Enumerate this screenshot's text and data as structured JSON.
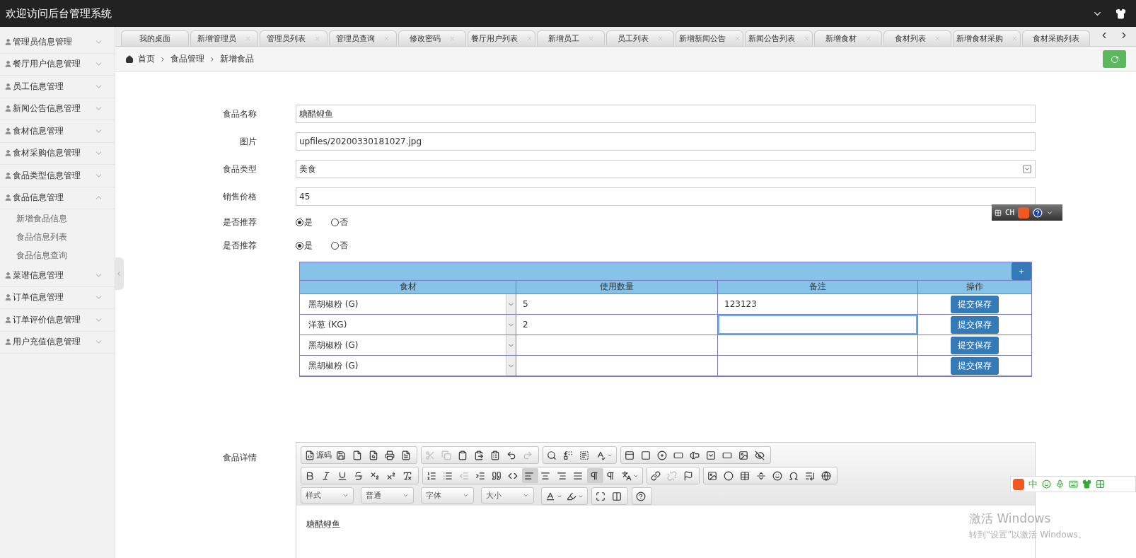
{
  "header": {
    "title": "欢迎访问后台管理系统"
  },
  "sidebar": {
    "items": [
      {
        "label": "管理员信息管理",
        "expanded": false
      },
      {
        "label": "餐厅用户信息管理",
        "expanded": false
      },
      {
        "label": "员工信息管理",
        "expanded": false
      },
      {
        "label": "新闻公告信息管理",
        "expanded": false
      },
      {
        "label": "食材信息管理",
        "expanded": false
      },
      {
        "label": "食材采购信息管理",
        "expanded": false
      },
      {
        "label": "食品类型信息管理",
        "expanded": false
      },
      {
        "label": "食品信息管理",
        "expanded": true,
        "children": [
          {
            "label": "新增食品信息"
          },
          {
            "label": "食品信息列表"
          },
          {
            "label": "食品信息查询"
          }
        ]
      },
      {
        "label": "菜谱信息管理",
        "expanded": false
      },
      {
        "label": "订单信息管理",
        "expanded": false
      },
      {
        "label": "订单评价信息管理",
        "expanded": false
      },
      {
        "label": "用户充值信息管理",
        "expanded": false
      }
    ]
  },
  "tabs": [
    {
      "label": "我的桌面",
      "closable": false,
      "selected": false
    },
    {
      "label": "新增管理员",
      "closable": true,
      "selected": false
    },
    {
      "label": "管理员列表",
      "closable": true,
      "selected": false
    },
    {
      "label": "管理员查询",
      "closable": true,
      "selected": false
    },
    {
      "label": "修改密码",
      "closable": true,
      "selected": false
    },
    {
      "label": "餐厅用户列表",
      "closable": true,
      "selected": false
    },
    {
      "label": "新增员工",
      "closable": true,
      "selected": false
    },
    {
      "label": "员工列表",
      "closable": true,
      "selected": false
    },
    {
      "label": "新增新闻公告",
      "closable": true,
      "selected": false
    },
    {
      "label": "新闻公告列表",
      "closable": true,
      "selected": false
    },
    {
      "label": "新增食材",
      "closable": true,
      "selected": false
    },
    {
      "label": "食材列表",
      "closable": true,
      "selected": false
    },
    {
      "label": "新增食材采购",
      "closable": true,
      "selected": false
    },
    {
      "label": "食材采购列表",
      "closable": false,
      "selected": false
    }
  ],
  "breadcrumb": [
    "首页",
    "食品管理",
    "新增食品"
  ],
  "form": {
    "fields": [
      {
        "kind": "text",
        "label": "食品名称",
        "value": "糖醋鲤鱼"
      },
      {
        "kind": "text",
        "label": "图片",
        "value": "upfiles/20200330181027.jpg"
      },
      {
        "kind": "select",
        "label": "食品类型",
        "value": "美食"
      },
      {
        "kind": "text",
        "label": "销售价格",
        "value": "45"
      },
      {
        "kind": "radio",
        "label": "是否推荐",
        "options": [
          {
            "label": "是",
            "selected": true
          },
          {
            "label": "否",
            "selected": false
          }
        ]
      },
      {
        "kind": "radio",
        "label": "是否推荐",
        "options": [
          {
            "label": "是",
            "selected": true
          },
          {
            "label": "否",
            "selected": false
          }
        ]
      }
    ]
  },
  "ingredients": {
    "add_button": "+",
    "columns": [
      "食材",
      "使用数量",
      "备注",
      "操作"
    ],
    "rows": [
      {
        "material": "黑胡椒粉 (G)",
        "quantity": "5",
        "note": "123123",
        "action": "提交保存",
        "focused": false
      },
      {
        "material": "洋葱 (KG)",
        "quantity": "2",
        "note": "",
        "action": "提交保存",
        "focused": true
      },
      {
        "material": "黑胡椒粉 (G)",
        "quantity": "",
        "note": "",
        "action": "提交保存",
        "focused": false
      },
      {
        "material": "黑胡椒粉 (G)",
        "quantity": "",
        "note": "",
        "action": "提交保存",
        "focused": false
      }
    ]
  },
  "editor": {
    "label": "食品详情",
    "toolbar_rows": [
      [
        [
          {
            "kind": "button",
            "label": "源码",
            "pressed": false,
            "disabled": false
          },
          {
            "kind": "button",
            "pressed": false,
            "disabled": false
          },
          {
            "kind": "button",
            "pressed": false,
            "disabled": false
          },
          {
            "kind": "button",
            "pressed": false,
            "disabled": false
          },
          {
            "kind": "button",
            "pressed": false,
            "disabled": false
          },
          {
            "kind": "button",
            "pressed": false,
            "disabled": false
          }
        ],
        [
          {
            "kind": "button",
            "pressed": false,
            "disabled": true
          },
          {
            "kind": "button",
            "pressed": false,
            "disabled": true
          },
          {
            "kind": "button",
            "pressed": false,
            "disabled": false
          },
          {
            "kind": "button",
            "pressed": false,
            "disabled": false
          },
          {
            "kind": "button",
            "pressed": false,
            "disabled": false
          },
          {
            "kind": "button",
            "pressed": false,
            "disabled": false
          },
          {
            "kind": "button",
            "pressed": false,
            "disabled": true
          }
        ],
        [
          {
            "kind": "button",
            "pressed": false,
            "disabled": false
          },
          {
            "kind": "button",
            "pressed": false,
            "disabled": false
          },
          {
            "kind": "button",
            "pressed": false,
            "disabled": false
          },
          {
            "kind": "button",
            "pressed": false,
            "disabled": false
          }
        ],
        [
          {
            "kind": "button",
            "pressed": false,
            "disabled": false
          },
          {
            "kind": "button",
            "pressed": false,
            "disabled": false
          },
          {
            "kind": "button",
            "pressed": false,
            "disabled": false
          },
          {
            "kind": "button",
            "pressed": false,
            "disabled": false
          },
          {
            "kind": "button",
            "pressed": false,
            "disabled": false
          },
          {
            "kind": "button",
            "pressed": false,
            "disabled": false
          },
          {
            "kind": "button",
            "pressed": false,
            "disabled": false
          },
          {
            "kind": "button",
            "pressed": false,
            "disabled": false
          },
          {
            "kind": "button",
            "pressed": false,
            "disabled": false
          }
        ]
      ],
      [
        [
          {
            "kind": "button",
            "pressed": false,
            "disabled": false
          },
          {
            "kind": "button",
            "pressed": false,
            "disabled": false
          },
          {
            "kind": "button",
            "pressed": false,
            "disabled": false
          },
          {
            "kind": "button",
            "pressed": false,
            "disabled": false
          },
          {
            "kind": "button",
            "pressed": false,
            "disabled": false
          },
          {
            "kind": "button",
            "pressed": false,
            "disabled": false
          },
          {
            "kind": "button",
            "pressed": false,
            "disabled": false
          }
        ],
        [
          {
            "kind": "button",
            "pressed": false,
            "disabled": false
          },
          {
            "kind": "button",
            "pressed": false,
            "disabled": false
          },
          {
            "kind": "button",
            "pressed": false,
            "disabled": true
          },
          {
            "kind": "button",
            "pressed": false,
            "disabled": false
          },
          {
            "kind": "button",
            "pressed": false,
            "disabled": false
          },
          {
            "kind": "button",
            "pressed": false,
            "disabled": false
          },
          {
            "kind": "button",
            "pressed": true,
            "disabled": false
          },
          {
            "kind": "button",
            "pressed": false,
            "disabled": false
          },
          {
            "kind": "button",
            "pressed": false,
            "disabled": false
          },
          {
            "kind": "button",
            "pressed": false,
            "disabled": false
          },
          {
            "kind": "button",
            "pressed": true,
            "disabled": false
          },
          {
            "kind": "button",
            "pressed": false,
            "disabled": false
          },
          {
            "kind": "button",
            "pressed": false,
            "disabled": false
          }
        ],
        [
          {
            "kind": "button",
            "pressed": false,
            "disabled": false
          },
          {
            "kind": "button",
            "pressed": false,
            "disabled": true
          },
          {
            "kind": "button",
            "pressed": false,
            "disabled": false
          }
        ],
        [
          {
            "kind": "button",
            "pressed": false,
            "disabled": false
          },
          {
            "kind": "button",
            "pressed": false,
            "disabled": false
          },
          {
            "kind": "button",
            "pressed": false,
            "disabled": false
          },
          {
            "kind": "button",
            "pressed": false,
            "disabled": false
          },
          {
            "kind": "button",
            "pressed": false,
            "disabled": false
          },
          {
            "kind": "button",
            "pressed": false,
            "disabled": false
          },
          {
            "kind": "button",
            "pressed": false,
            "disabled": false
          },
          {
            "kind": "button",
            "pressed": false,
            "disabled": false
          }
        ]
      ],
      [
        [
          {
            "kind": "combo",
            "label": "样式"
          },
          {
            "kind": "combo",
            "label": "普通"
          },
          {
            "kind": "combo",
            "label": "字体"
          },
          {
            "kind": "combo",
            "label": "大小"
          }
        ],
        [
          {
            "kind": "button",
            "pressed": false,
            "disabled": false
          },
          {
            "kind": "button",
            "pressed": false,
            "disabled": false
          }
        ],
        [
          {
            "kind": "button",
            "pressed": false,
            "disabled": false
          },
          {
            "kind": "button",
            "pressed": false,
            "disabled": false
          }
        ],
        [
          {
            "kind": "button",
            "pressed": false,
            "disabled": false
          }
        ]
      ]
    ],
    "content": "糖醋鲤鱼"
  },
  "ime_bar": {
    "language": "CH"
  },
  "ime_status": {
    "mode": "中"
  },
  "os_notice": {
    "title": "激活 Windows",
    "text": "转到“设置”以激活 Windows。"
  }
}
